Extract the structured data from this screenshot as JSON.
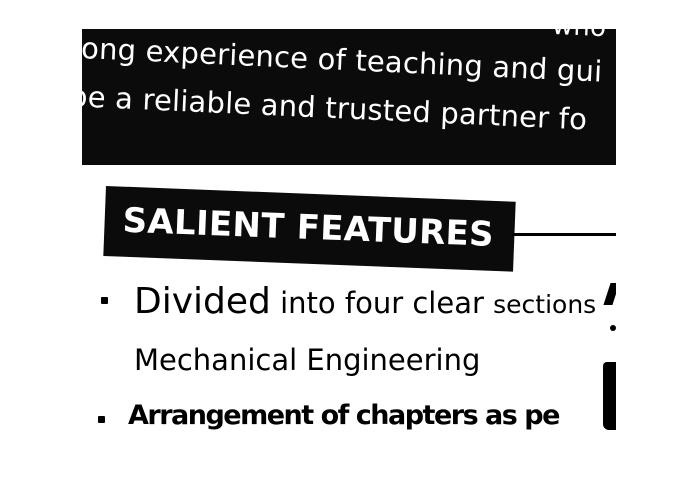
{
  "band": {
    "line1": "ong experience of teaching and gui",
    "line2": "be a reliable and trusted partner fo",
    "top_fragment": "who ha"
  },
  "heading": {
    "text": "SALIENT FEATURES"
  },
  "features": {
    "item1_word1": "Divided",
    "item1_word2": " into ",
    "item1_word3": "four clear ",
    "item1_word4": "sections",
    "item1_cont": "Mechanical Engineering",
    "item2": "Arrangement of chapters as pe"
  },
  "colors": {
    "ink": "#000000",
    "paper": "#ffffff",
    "band": "#0b0b0b"
  }
}
